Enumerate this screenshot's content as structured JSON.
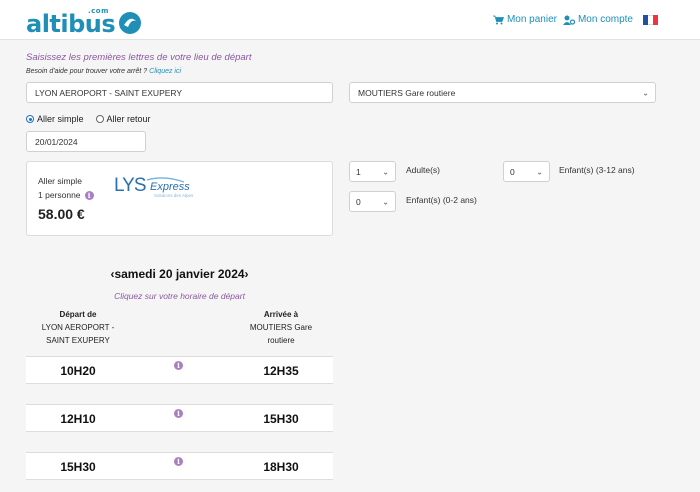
{
  "header": {
    "logo_text": "altibus",
    "logo_com": ".com",
    "cart_label": "Mon panier",
    "account_label": "Mon compte",
    "flag_colors": [
      "#2450a4",
      "#ffffff",
      "#ef3340"
    ]
  },
  "search": {
    "hint_departure": "Saisissez les premières lettres de votre lieu de départ",
    "help_text": "Besoin d'aide pour trouver votre arrêt ?",
    "help_link": "Cliquez ici",
    "departure_value": "LYON AEROPORT - SAINT EXUPERY",
    "arrival_value": "MOUTIERS Gare routiere",
    "trip_options": [
      "Aller simple",
      "Aller retour"
    ],
    "trip_selected": "Aller simple",
    "date_value": "20/01/2024"
  },
  "price_card": {
    "trip_type": "Aller simple",
    "persons": "1 personne",
    "price": "58.00 €",
    "operator_logo": "LYS Express",
    "operator_tagline": "Solutions des Alpes"
  },
  "passengers": {
    "adults_value": "1",
    "adults_label": "Adulte(s)",
    "children_value": "0",
    "children_label": "Enfant(s) (3-12 ans)",
    "infants_value": "0",
    "infants_label": "Enfant(s) (0-2 ans)"
  },
  "schedule": {
    "prev_arrow": "‹",
    "date_title": "samedi 20 janvier 2024",
    "next_arrow": "›",
    "click_hint": "Cliquez sur votre horaire de départ",
    "departure_header": "Départ de",
    "departure_place_1": "LYON AEROPORT -",
    "departure_place_2": "SAINT EXUPERY",
    "arrival_header": "Arrivée à",
    "arrival_place_1": "MOUTIERS Gare",
    "arrival_place_2": "routiere",
    "rows": [
      {
        "departure": "10H20",
        "arrival": "12H35"
      },
      {
        "departure": "12H10",
        "arrival": "15H30"
      },
      {
        "departure": "15H30",
        "arrival": "18H30"
      }
    ]
  },
  "colors": {
    "brand": "#1f8fb8",
    "accent_purple": "#8a58a0",
    "info_badge": "#a97fc4"
  }
}
